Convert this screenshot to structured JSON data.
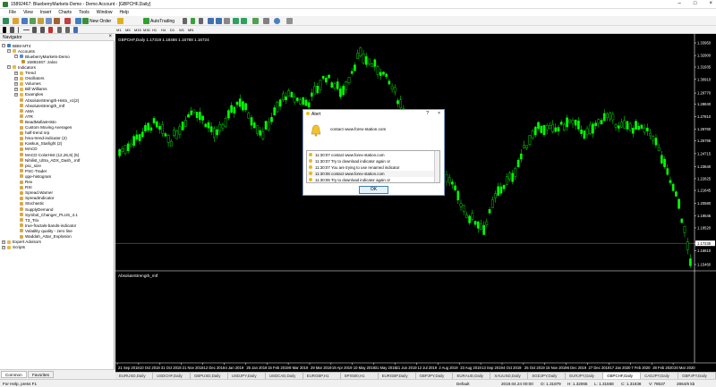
{
  "window": {
    "title": "15892467: BlueberryMarkets-Demo - Demo Account - [GBPCHF,Daily]",
    "controls": [
      "–",
      "□",
      "×"
    ]
  },
  "menu": [
    "File",
    "View",
    "Insert",
    "Charts",
    "Tools",
    "Window",
    "Help"
  ],
  "toolbar": {
    "new_order": "New Order",
    "autotrading": "AutoTrading",
    "timeframes": [
      "M1",
      "M5",
      "M15",
      "M30",
      "H1",
      "H4",
      "D1",
      "W1",
      "MN"
    ]
  },
  "navigator": {
    "title": "Navigator",
    "close": "×",
    "root": "BBM MT4",
    "accounts_label": "Accounts",
    "account_server": "BlueberryMarkets-Demo",
    "account_id": "15892467: zaloo",
    "indicators_label": "Indicators",
    "indicator_folders": [
      "Trend",
      "Oscillators",
      "Volumes",
      "Bill Williams",
      "Examples"
    ],
    "indicator_items": [
      "AbsoluteStrength-Histo_v1(2)",
      "AbsoluteStrength_mtf",
      "AMA",
      "ATR",
      "BeadMafiasHisto",
      "Custom Moving Averages",
      "half-trend nrp",
      "hma-trend-indicator (2)",
      "Kaskus_Starlight (2)",
      "MACD",
      "MACD ColorHist (12,26,9) (5)",
      "Nihilist_Ultra_ADX_Dash_.mtf",
      "psc_size",
      "PSC-Trader",
      "qqe-histogram",
      "Rex",
      "RSI",
      "Spread.Warner",
      "SpreadIndicator",
      "Stochastic",
      "SupplyDemand",
      "Symbol_Changer_PLUS_4.1",
      "T3_Trix",
      "true-fractals-bands-indicator",
      "Volatility quality - zero line",
      "Waddah_Attar_Explosion"
    ],
    "bottom_folders": [
      "Expert Advisors",
      "Scripts"
    ],
    "tabs": [
      "Common",
      "Favorites"
    ]
  },
  "chart": {
    "header": "GBPCHF,Daily  1.17319 1.18466 1.16788 1.16724",
    "subwindow_label": "AbsoluteStrength_mtf",
    "price_labels": [
      "1.33950",
      "1.32900",
      "1.31935",
      "1.30910",
      "1.29770",
      "1.28840",
      "1.27810",
      "1.26760",
      "1.25785",
      "1.24715",
      "1.23640",
      "1.22625",
      "1.21645",
      "1.20580",
      "1.19545",
      "1.18520",
      "1.17235",
      "1.16610",
      "1.15460"
    ],
    "current_price": "1.17235",
    "date_labels": [
      "21 Sep 2018",
      "10 Oct 2018",
      "31 Oct 2018",
      "21 Nov 2018",
      "12 Dec 2018",
      "4 Jan 2019",
      "25 Jan 2019",
      "15 Feb 2019",
      "8 Mar 2019",
      "29 Mar 2019",
      "19 Apr 2019",
      "10 May 2019",
      "31 May 2019",
      "21 Jun 2019",
      "12 Jul 2019",
      "2 Aug 2019",
      "23 Aug 2019",
      "13 Sep 2019",
      "4 Oct 2019",
      "25 Oct 2019",
      "15 Nov 2019",
      "6 Dec 2019",
      "27 Dec 2019",
      "17 Jan 2020",
      "7 Feb 2020",
      "28 Feb 2020",
      "20 Mar 2020"
    ],
    "bull_color": "#00ff00",
    "bear_color": "#00ff00"
  },
  "symbol_tabs": [
    "EURUSD,Daily",
    "USDCHF,Daily",
    "GBPUSD,Daily",
    "USDJPY,Daily",
    "USDCAD,Daily",
    "EURGBP,H1",
    "SPX500,H1",
    "EURGBP,Daily",
    "GBPJPY,Daily",
    "EURAUD,Daily",
    "XAUUSD,Daily",
    "SGDJPY,Daily",
    "EURJPY,Daily",
    "GBPCHF,Daily",
    "CADJPY,Daily",
    "GBPJPY,Daily"
  ],
  "alert": {
    "title": "Alert",
    "help": "?",
    "close": "×",
    "message": "contact www.forex-station.com",
    "rows": [
      {
        "time": "11:30:07",
        "msg": "contact www.forex-station.com"
      },
      {
        "time": "11:30:07",
        "msg": "Try to download indicator again or"
      },
      {
        "time": "11:30:07",
        "msg": "You are trying to use renamed indicator"
      },
      {
        "time": "11:30:06",
        "msg": "contact www.forex-station.com"
      },
      {
        "time": "11:30:06",
        "msg": "Try to download indicator again or"
      }
    ],
    "ok_label": "OK"
  },
  "status": {
    "help": "For Help, press F1",
    "profile": "Default",
    "datetime": "2019.04.24 00:00",
    "open": "O: 1.31879",
    "high": "H: 1.32065",
    "low": "L: 1.31558",
    "close": "C: 1.31638",
    "volume": "V: 78537",
    "traffic": "2864/6 kb"
  }
}
